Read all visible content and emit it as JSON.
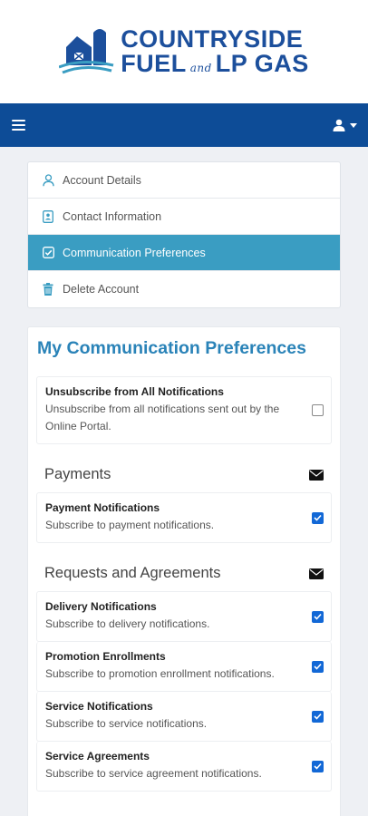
{
  "brand": {
    "line1": "COUNTRYSIDE",
    "line2a": "FUEL",
    "line2and": "and",
    "line2b": "LP GAS",
    "color": "#1c4f9c"
  },
  "navbar": {
    "menu_icon": "hamburger-icon",
    "user_icon": "user-icon",
    "color": "#0d4c97"
  },
  "menu": {
    "items": [
      {
        "label": "Account Details",
        "icon": "user-outline-icon",
        "active": false
      },
      {
        "label": "Contact Information",
        "icon": "contact-card-icon",
        "active": false
      },
      {
        "label": "Communication Preferences",
        "icon": "check-square-icon",
        "active": true
      },
      {
        "label": "Delete Account",
        "icon": "trash-icon",
        "active": false
      }
    ],
    "active_color": "#3a9dc2"
  },
  "prefs": {
    "title": "My Communication Preferences",
    "unsubscribe": {
      "title": "Unsubscribe from All Notifications",
      "desc": "Unsubscribe from all notifications sent out by the Online Portal.",
      "checked": false
    },
    "sections": [
      {
        "title": "Payments",
        "icon": "envelope-icon",
        "items": [
          {
            "title": "Payment Notifications",
            "desc": "Subscribe to payment notifications.",
            "checked": true
          }
        ]
      },
      {
        "title": "Requests and Agreements",
        "icon": "envelope-icon",
        "items": [
          {
            "title": "Delivery Notifications",
            "desc": "Subscribe to delivery notifications.",
            "checked": true
          },
          {
            "title": "Promotion Enrollments",
            "desc": "Subscribe to promotion enrollment notifications.",
            "checked": true
          },
          {
            "title": "Service Notifications",
            "desc": "Subscribe to service notifications.",
            "checked": true
          },
          {
            "title": "Service Agreements",
            "desc": "Subscribe to service agreement notifications.",
            "checked": true
          }
        ]
      }
    ]
  }
}
